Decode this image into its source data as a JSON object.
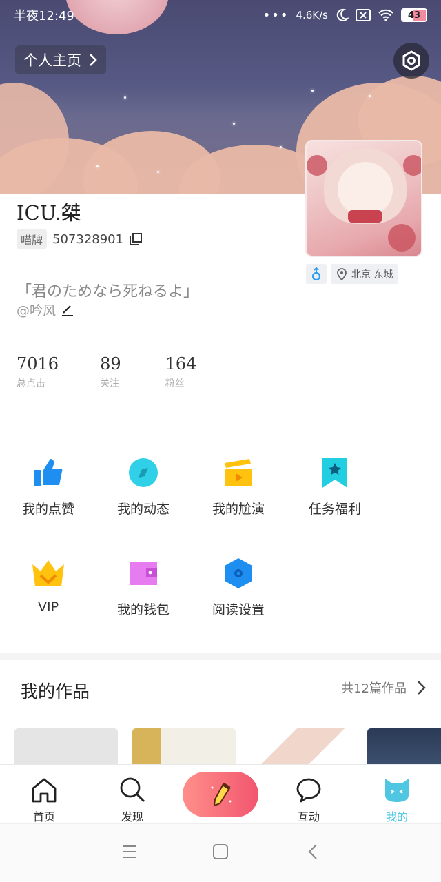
{
  "status_bar": {
    "time": "半夜12:49",
    "network_speed": "4.6K/s",
    "battery": "43",
    "battery_level": 0.43
  },
  "header": {
    "home_label": "个人主页",
    "settings_icon": "settings-hexagon-icon"
  },
  "profile": {
    "nickname": "ICU.桀",
    "id_badge": "喵牌",
    "id_number": "507328901",
    "signature": "「君のためなら死ねるよ」",
    "author": "@吟风",
    "gender_icon": "male-icon",
    "location": "北京 东城"
  },
  "stats": [
    {
      "value": "7016",
      "label": "总点击"
    },
    {
      "value": "89",
      "label": "关注"
    },
    {
      "value": "164",
      "label": "粉丝"
    }
  ],
  "menu": [
    {
      "label": "我的点赞",
      "icon": "thumbs-up-icon",
      "color": "#1e8ef0"
    },
    {
      "label": "我的动态",
      "icon": "compass-icon",
      "color": "#2fd0e8"
    },
    {
      "label": "我的尬演",
      "icon": "clapperboard-icon",
      "color": "#ffc20e"
    },
    {
      "label": "任务福利",
      "icon": "bookmark-star-icon",
      "color": "#22cfe0"
    },
    {
      "label": "VIP",
      "icon": "crown-icon",
      "color": "#ffc20e"
    },
    {
      "label": "我的钱包",
      "icon": "wallet-icon",
      "color": "#e77cf0"
    },
    {
      "label": "阅读设置",
      "icon": "hexagon-settings-icon",
      "color": "#1e8ef0"
    }
  ],
  "works": {
    "title": "我的作品",
    "count": "共12篇作品"
  },
  "tabbar": [
    {
      "label": "首页",
      "icon": "home-icon"
    },
    {
      "label": "发现",
      "icon": "search-icon"
    },
    {
      "label": "",
      "icon": "pencil-icon"
    },
    {
      "label": "互动",
      "icon": "chat-bubble-icon"
    },
    {
      "label": "我的",
      "icon": "cat-face-icon",
      "active": true
    }
  ],
  "colors": {
    "accent": "#4fc7e3",
    "write_button": "#f2566f"
  }
}
